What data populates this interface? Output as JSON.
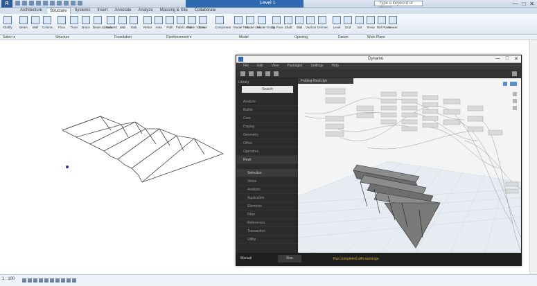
{
  "titlebar": {
    "app_button": "R",
    "title": "Level 1",
    "search_placeholder": "Type a keyword or phrase",
    "controls": [
      "—",
      "□",
      "✕"
    ]
  },
  "ribbon": {
    "tabs": [
      "Architecture",
      "Structure",
      "Systems",
      "Insert",
      "Annotate",
      "Analyze",
      "Massing & Site",
      "Collaborate"
    ],
    "active_tab": "Structure",
    "buttons": [
      "Modify",
      "Beam",
      "Wall",
      "Column",
      "Floor",
      "Truss",
      "Brace",
      "Beam System",
      "Isolated",
      "Wall",
      "Slab",
      "Rebar",
      "Area",
      "Path",
      "Fabric Area",
      "Fabric Sheet",
      "Cover",
      "Component",
      "Model Text",
      "Model Line",
      "Model Group",
      "By Face",
      "Shaft",
      "Wall",
      "Vertical",
      "Dormer",
      "Level",
      "Grid",
      "Set",
      "Show",
      "Ref Plane",
      "Viewer"
    ],
    "panels": [
      "Select ▾",
      "Structure",
      "Foundation",
      "Reinforcement ▾",
      "Model",
      "Opening",
      "Datum",
      "Work Plane"
    ]
  },
  "optionsbar": {
    "label": "Select ▾"
  },
  "statusbar": {
    "scale": "1 : 100"
  },
  "dynamo": {
    "title": "Dynamo",
    "menu": [
      "File",
      "Edit",
      "View",
      "Packages",
      "Settings",
      "Help"
    ],
    "library_header": "Library",
    "search_label": "Search",
    "library_items": [
      "Analyze",
      "Builtin",
      "Core",
      "Display",
      "Geometry",
      "Office",
      "Operators",
      "Revit"
    ],
    "revit_subitems": [
      "Selection",
      "Views",
      "Analysis",
      "Application",
      "Elements",
      "Filter",
      "References",
      "Transaction",
      "Utility"
    ],
    "workspace_tab": "Folding-Roof.dyn",
    "run_mode": "Manual",
    "run_button": "Run",
    "run_status": "Run completed with warnings."
  }
}
